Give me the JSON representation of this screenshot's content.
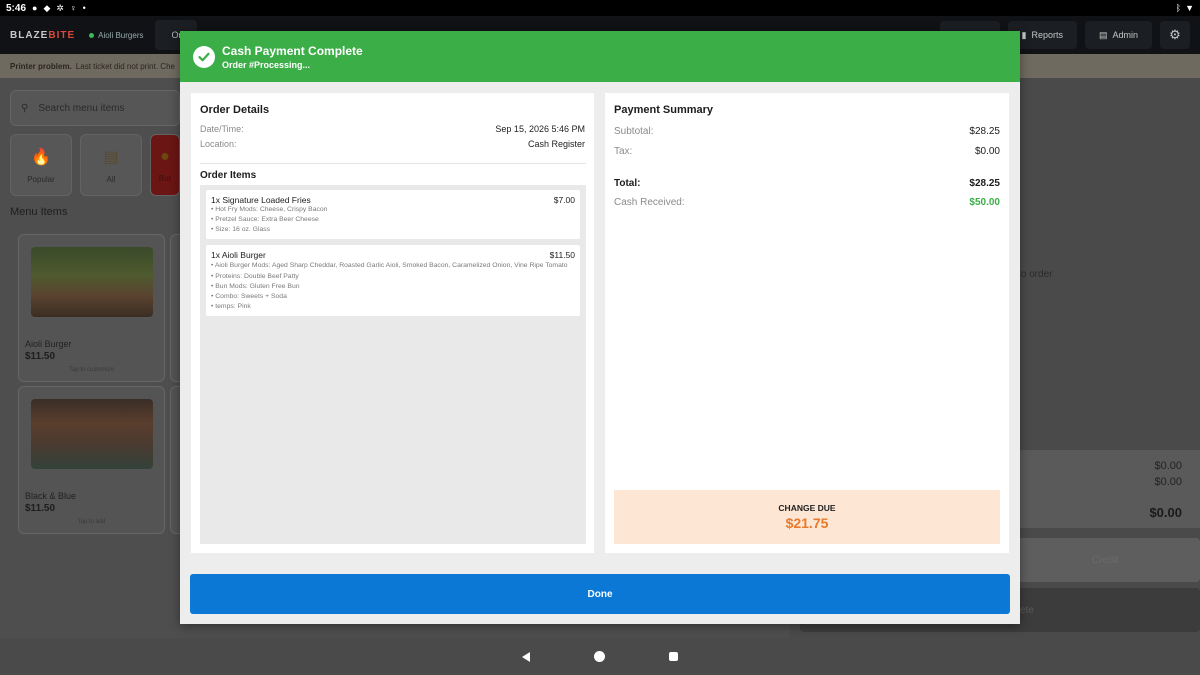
{
  "status_bar": {
    "time": "5:46"
  },
  "topbar": {
    "brand_main": "BLAZE",
    "brand_accent": "BITE",
    "store_name": "Aioli Burgers",
    "tab_label": "Or",
    "reports_label": "Reports",
    "admin_label": "Admin"
  },
  "banner": {
    "bold": "Printer problem.",
    "text": "Last ticket did not print. Che"
  },
  "menu": {
    "search_placeholder": "Search menu items",
    "categories": [
      {
        "label": "Popular",
        "icon": "fire-icon"
      },
      {
        "label": "All",
        "icon": "clipboard-icon"
      },
      {
        "label": "Bur",
        "icon": "burger-icon"
      }
    ],
    "section_title": "Menu Items",
    "items": [
      {
        "name": "Aioli Burger",
        "price": "$11.50",
        "hint": "Tap to customize"
      },
      {
        "name": "Black & Blue",
        "price": "$11.50",
        "hint": "Tap to add"
      }
    ]
  },
  "order_panel": {
    "empty_hint": "to order",
    "total_1": "$0.00",
    "total_2": "$0.00",
    "total_3": "$0.00",
    "credit_label": "Credit",
    "complete_label": "ete"
  },
  "modal": {
    "title": "Cash Payment Complete",
    "subtitle": "Order #Processing...",
    "order_details": {
      "title": "Order Details",
      "date_label": "Date/Time:",
      "date_value": "Sep 15, 2026 5:46 PM",
      "location_label": "Location:",
      "location_value": "Cash Register",
      "items_title": "Order Items",
      "items": [
        {
          "name": "1x Signature Loaded Fries",
          "price": "$7.00",
          "mods": [
            "• Hot Fry Mods: Cheese, Crispy Bacon",
            "• Pretzel Sauce: Extra Beer Cheese",
            "• Size: 16 oz. Glass"
          ]
        },
        {
          "name": "1x Aioli Burger",
          "price": "$11.50",
          "mods": [
            "• Aioli Burger Mods: Aged Sharp Cheddar, Roasted Garlic Aioli, Smoked Bacon, Caramelized Onion, Vine Ripe Tomato",
            "• Proteins: Double Beef Patty",
            "• Bun Mods: Gluten Free Bun",
            "• Combo: Sweets + Soda",
            "• temps: Pink"
          ]
        }
      ]
    },
    "payment_summary": {
      "title": "Payment Summary",
      "subtotal_label": "Subtotal:",
      "subtotal_value": "$28.25",
      "tax_label": "Tax:",
      "tax_value": "$0.00",
      "total_label": "Total:",
      "total_value": "$28.25",
      "cash_label": "Cash Received:",
      "cash_value": "$50.00",
      "change_label": "CHANGE DUE",
      "change_value": "$21.75"
    },
    "done_label": "Done"
  },
  "colors": {
    "success_green": "#3cae48",
    "primary_blue": "#0a78d4",
    "change_orange": "#e87a2c",
    "change_bg": "#fde6d3"
  }
}
